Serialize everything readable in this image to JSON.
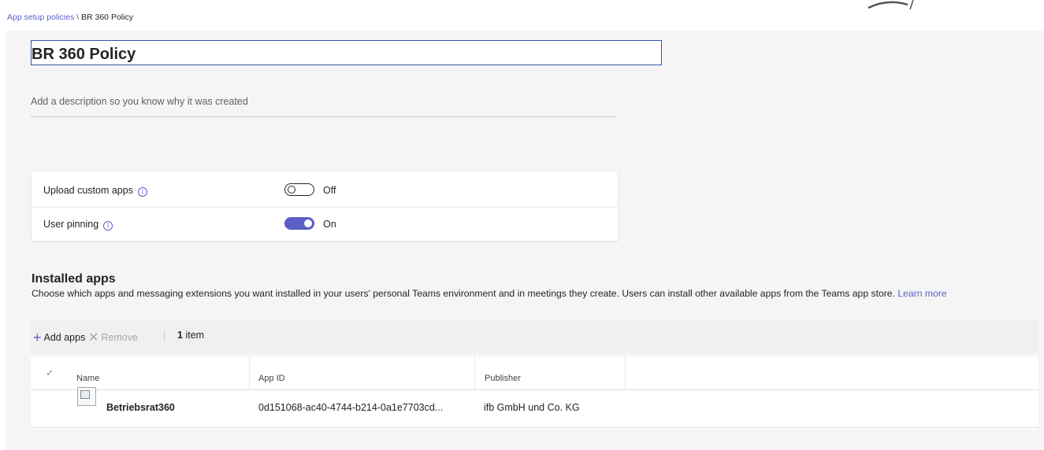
{
  "breadcrumb": {
    "parent": "App setup policies",
    "separator": "\\",
    "current": "BR 360 Policy"
  },
  "policy": {
    "name": "BR 360 Policy",
    "description_placeholder": "Add a description so you know why it was created"
  },
  "settings": [
    {
      "label": "Upload custom apps",
      "info_icon": "info-icon",
      "state": "Off",
      "enabled": false
    },
    {
      "label": "User pinning",
      "info_icon": "info-icon",
      "state": "On",
      "enabled": true
    }
  ],
  "installed_apps": {
    "title": "Installed apps",
    "description": "Choose which apps and messaging extensions you want installed in your users' personal Teams environment and in meetings they create. Users can install other available apps from the Teams app store.",
    "learn_more": "Learn more",
    "toolbar": {
      "add_label": "Add apps",
      "remove_label": "Remove",
      "divider": "|",
      "count_number": "1",
      "count_unit": "item"
    },
    "columns": [
      "Name",
      "App ID",
      "Publisher"
    ],
    "check_glyph": "✓",
    "rows": [
      {
        "name": "Betriebsrat360",
        "app_id": "0d151068-ac40-4744-b214-0a1e7703cd...",
        "publisher": "ifb GmbH und Co. KG",
        "icon": "broken-image-icon"
      }
    ]
  },
  "colors": {
    "accent": "#5b5fc7",
    "title_border": "#2b5aa6",
    "background": "#f5f5f5"
  }
}
